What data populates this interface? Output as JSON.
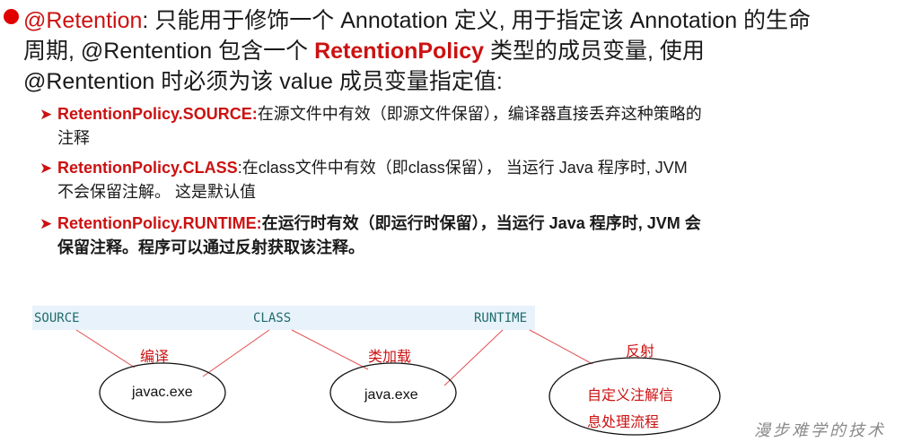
{
  "main": {
    "prefix": "@Retention",
    "line1_rest": ": 只能用于修饰一个 Annotation 定义, 用于指定该 Annotation 的生命",
    "line2_a": "周期, @Rentention 包含一个 ",
    "line2_policy": "RetentionPolicy",
    "line2_b": " 类型的成员变量, 使用",
    "line3": "@Rentention 时必须为该 value 成员变量指定值:"
  },
  "items": [
    {
      "key": "RetentionPolicy.SOURCE:",
      "text": "在源文件中有效（即源文件保留），编译器直接丢弃这种策略的",
      "cont": "注释"
    },
    {
      "key": "RetentionPolicy.CLASS",
      "text": ":在class文件中有效（即class保留）， 当运行 Java 程序时, JVM",
      "cont": "不会保留注解。 这是默认值"
    },
    {
      "key": "RetentionPolicy.RUNTIME:",
      "text": "在运行时有效（即运行时保留），当运行 Java 程序时, JVM 会",
      "cont": "保留注释。程序可以通过反射获取该注释。"
    }
  ],
  "diagram": {
    "stages": [
      "SOURCE",
      "CLASS",
      "RUNTIME"
    ],
    "labels": [
      "编译",
      "类加载",
      "反射"
    ],
    "ovals": [
      "javac.exe",
      "java.exe"
    ],
    "reflect_line1": "自定义注解信",
    "reflect_line2": "息处理流程"
  },
  "watermark": "漫步难学的技术",
  "colors": {
    "accent": "#cc1111",
    "band": "#e8f2fb",
    "mono": "#1e6b6b"
  }
}
